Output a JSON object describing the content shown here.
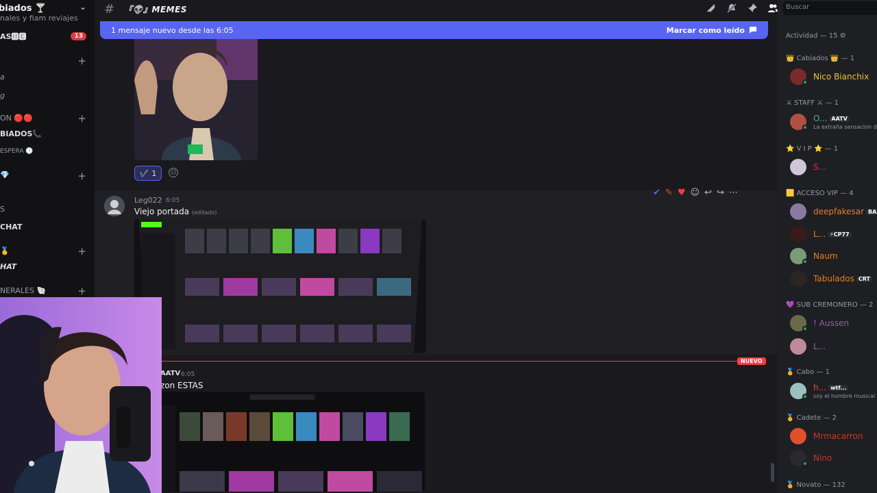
{
  "server": {
    "header": "biados 🍸",
    "subtext": "nales y fiam reviajes",
    "unread_badge": "13"
  },
  "sidebar": {
    "rows": [
      {
        "label": "AS🅼🅴",
        "bold": true
      },
      {
        "label": "a",
        "italic": true
      },
      {
        "label": "g",
        "italic": true
      },
      {
        "label": "ON 🔴🔴",
        "bold": false
      },
      {
        "label": "BIADOS📞",
        "bold": true
      },
      {
        "label": "ESPERA 🕓",
        "bold": false
      },
      {
        "label": "💎",
        "bold": false
      },
      {
        "label": "S",
        "bold": false
      },
      {
        "label": "CHAT",
        "bold": true
      },
      {
        "label": "🥇",
        "bold": false
      },
      {
        "label": "HAT",
        "italic": true
      },
      {
        "label": "NERALES 🐚",
        "bold": false
      }
    ]
  },
  "channel": {
    "name": "『👽』MEMES"
  },
  "topbar": {
    "icons": [
      "threads-icon",
      "mute-icon",
      "pin-icon",
      "members-icon"
    ]
  },
  "banner": {
    "text": "1 mensaje nuevo desde las 6:05",
    "action": "Marcar como leído"
  },
  "reaction": {
    "emoji": "✔️",
    "count": "1"
  },
  "messages": [
    {
      "author": "Leg022",
      "time": "6:05",
      "text": "Viejo portada",
      "edited": "(editado)"
    },
    {
      "author": "AATV",
      "time": "6:05",
      "text": "zon ESTAS"
    }
  ],
  "new_marker": "NUEVO",
  "search": {
    "placeholder": "Buscar"
  },
  "members": {
    "activity": "Actividad — 15 ⚙",
    "groups": [
      {
        "title": "👑 Cabiados 👑 — 1",
        "items": [
          {
            "name": "Nico Bianchix",
            "color": "#f0c040",
            "sub": "",
            "tag": ""
          }
        ]
      },
      {
        "title": "⚔ STAFF ⚔ — 1",
        "items": [
          {
            "name": "O...",
            "color": "#43b581",
            "sub": "La extraña sensacion de",
            "tag": "AATV"
          }
        ]
      },
      {
        "title": "⭐ V I P ⭐ — 1",
        "items": [
          {
            "name": "S...",
            "color": "#e91e63",
            "sub": "",
            "tag": ""
          }
        ]
      },
      {
        "title": "🟨 ACCESO VIP — 4",
        "items": [
          {
            "name": "deepfakesar",
            "color": "#e67e22",
            "sub": "",
            "tag": "BA"
          },
          {
            "name": "L...",
            "color": "#e67e22",
            "sub": "",
            "tag": "⚡CP77"
          },
          {
            "name": "Naum",
            "color": "#e67e22",
            "sub": "",
            "tag": ""
          },
          {
            "name": "Tabulados",
            "color": "#e67e22",
            "sub": "",
            "tag": "CRT"
          }
        ]
      },
      {
        "title": "💜 SUB CREMONERO — 2",
        "items": [
          {
            "name": "! Aussen",
            "color": "#9b59b6",
            "sub": "",
            "tag": ""
          },
          {
            "name": "L...",
            "color": "#9b59b6",
            "sub": "",
            "tag": ""
          }
        ]
      },
      {
        "title": "🏅 Cabo — 1",
        "items": [
          {
            "name": "h...",
            "color": "#e74c3c",
            "sub": "soy el hombre musical",
            "tag": "wtf..."
          }
        ]
      },
      {
        "title": "🏅 Cadete — 2",
        "items": [
          {
            "name": "Mrmacarron",
            "color": "#c0392b",
            "sub": "",
            "tag": ""
          },
          {
            "name": "Nino",
            "color": "#c0392b",
            "sub": "",
            "tag": ""
          }
        ]
      },
      {
        "title": "🏅 Novato — 132",
        "items": []
      }
    ]
  }
}
